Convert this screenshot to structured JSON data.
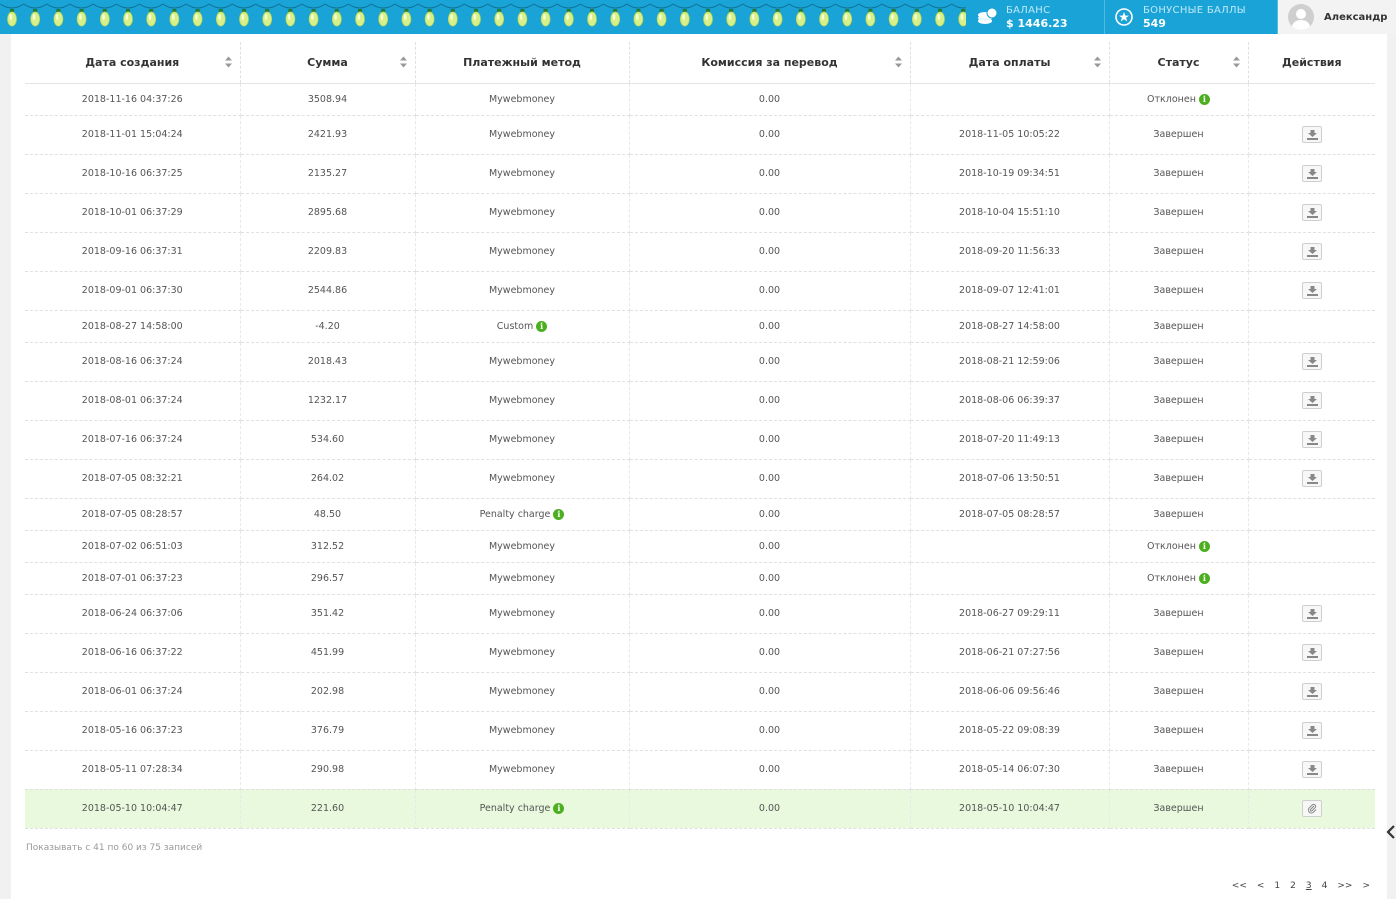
{
  "header": {
    "balance_label": "БАЛАНС",
    "balance_value": "$ 1446.23",
    "bonus_label": "БОНУСНЫЕ БАЛЛЫ",
    "bonus_value": "549",
    "user_name": "Александр",
    "accent": "#1aa3d6"
  },
  "table": {
    "columns": [
      "Дата создания",
      "Сумма",
      "Платежный метод",
      "Комиссия за перевод",
      "Дата оплаты",
      "Статус",
      "Действия"
    ],
    "rows": [
      {
        "created": "2018-11-16 04:37:26",
        "amount": "3508.94",
        "method": "Mywebmoney",
        "fee": "0.00",
        "paid": "",
        "status": "Отклонен"
      },
      {
        "created": "2018-11-01 15:04:24",
        "amount": "2421.93",
        "method": "Mywebmoney",
        "fee": "0.00",
        "paid": "2018-11-05 10:05:22",
        "status": "Завершен"
      },
      {
        "created": "2018-10-16 06:37:25",
        "amount": "2135.27",
        "method": "Mywebmoney",
        "fee": "0.00",
        "paid": "2018-10-19 09:34:51",
        "status": "Завершен"
      },
      {
        "created": "2018-10-01 06:37:29",
        "amount": "2895.68",
        "method": "Mywebmoney",
        "fee": "0.00",
        "paid": "2018-10-04 15:51:10",
        "status": "Завершен"
      },
      {
        "created": "2018-09-16 06:37:31",
        "amount": "2209.83",
        "method": "Mywebmoney",
        "fee": "0.00",
        "paid": "2018-09-20 11:56:33",
        "status": "Завершен"
      },
      {
        "created": "2018-09-01 06:37:30",
        "amount": "2544.86",
        "method": "Mywebmoney",
        "fee": "0.00",
        "paid": "2018-09-07 12:41:01",
        "status": "Завершен"
      },
      {
        "created": "2018-08-27 14:58:00",
        "amount": "-4.20",
        "method": "Custom",
        "fee": "0.00",
        "paid": "2018-08-27 14:58:00",
        "status": "Завершен"
      },
      {
        "created": "2018-08-16 06:37:24",
        "amount": "2018.43",
        "method": "Mywebmoney",
        "fee": "0.00",
        "paid": "2018-08-21 12:59:06",
        "status": "Завершен"
      },
      {
        "created": "2018-08-01 06:37:24",
        "amount": "1232.17",
        "method": "Mywebmoney",
        "fee": "0.00",
        "paid": "2018-08-06 06:39:37",
        "status": "Завершен"
      },
      {
        "created": "2018-07-16 06:37:24",
        "amount": "534.60",
        "method": "Mywebmoney",
        "fee": "0.00",
        "paid": "2018-07-20 11:49:13",
        "status": "Завершен"
      },
      {
        "created": "2018-07-05 08:32:21",
        "amount": "264.02",
        "method": "Mywebmoney",
        "fee": "0.00",
        "paid": "2018-07-06 13:50:51",
        "status": "Завершен"
      },
      {
        "created": "2018-07-05 08:28:57",
        "amount": "48.50",
        "method": "Penalty charge",
        "fee": "0.00",
        "paid": "2018-07-05 08:28:57",
        "status": "Завершен"
      },
      {
        "created": "2018-07-02 06:51:03",
        "amount": "312.52",
        "method": "Mywebmoney",
        "fee": "0.00",
        "paid": "",
        "status": "Отклонен"
      },
      {
        "created": "2018-07-01 06:37:23",
        "amount": "296.57",
        "method": "Mywebmoney",
        "fee": "0.00",
        "paid": "",
        "status": "Отклонен"
      },
      {
        "created": "2018-06-24 06:37:06",
        "amount": "351.42",
        "method": "Mywebmoney",
        "fee": "0.00",
        "paid": "2018-06-27 09:29:11",
        "status": "Завершен"
      },
      {
        "created": "2018-06-16 06:37:22",
        "amount": "451.99",
        "method": "Mywebmoney",
        "fee": "0.00",
        "paid": "2018-06-21 07:27:56",
        "status": "Завершен"
      },
      {
        "created": "2018-06-01 06:37:24",
        "amount": "202.98",
        "method": "Mywebmoney",
        "fee": "0.00",
        "paid": "2018-06-06 09:56:46",
        "status": "Завершен"
      },
      {
        "created": "2018-05-16 06:37:23",
        "amount": "376.79",
        "method": "Mywebmoney",
        "fee": "0.00",
        "paid": "2018-05-22 09:08:39",
        "status": "Завершен"
      },
      {
        "created": "2018-05-11 07:28:34",
        "amount": "290.98",
        "method": "Mywebmoney",
        "fee": "0.00",
        "paid": "2018-05-14 06:07:30",
        "status": "Завершен"
      },
      {
        "created": "2018-05-10 10:04:47",
        "amount": "221.60",
        "method": "Penalty charge",
        "fee": "0.00",
        "paid": "2018-05-10 10:04:47",
        "status": "Завершен"
      }
    ]
  },
  "footer": {
    "records_info": "Показывать с 41 по 60 из 75 записей",
    "pager": [
      "<<",
      "<",
      "1",
      "2",
      "3",
      "4",
      ">>",
      ">"
    ],
    "active_page": "3"
  },
  "icons": {
    "coins": "coins-icon",
    "star": "star-badge-icon",
    "info": "info-icon",
    "download": "download-icon",
    "attachment": "paperclip-icon",
    "sort": "sort-icon"
  }
}
